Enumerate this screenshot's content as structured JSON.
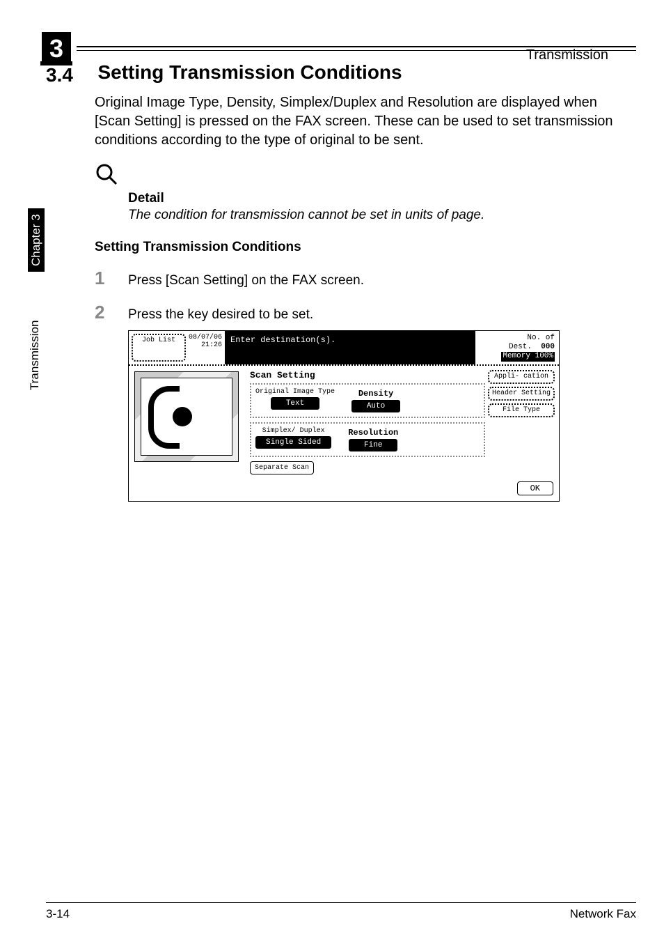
{
  "header": {
    "chapter_num": "3",
    "title": "Transmission"
  },
  "sidebar": {
    "chapter_label": "Chapter 3",
    "section_label": "Transmission"
  },
  "section": {
    "number": "3.4",
    "title": "Setting Transmission Conditions",
    "intro": "Original Image Type, Density, Simplex/Duplex and Resolution are displayed when [Scan Setting] is pressed on the FAX screen. These can be used to set transmission conditions according to the type of original to be sent."
  },
  "detail": {
    "label": "Detail",
    "text": "The condition for transmission cannot be set in units of page."
  },
  "subheading": "Setting Transmission Conditions",
  "steps": [
    {
      "num": "1",
      "text": "Press [Scan Setting] on the FAX screen."
    },
    {
      "num": "2",
      "text": "Press the key desired to be set."
    }
  ],
  "shot": {
    "job_list": "Job List",
    "date": "08/07/06",
    "time": "21:26",
    "prompt": "Enter destination(s).",
    "no_of_dest_label": "No. of Dest.",
    "no_of_dest_val": "000",
    "memory_label": "Memory",
    "memory_val": "100%",
    "panel_title": "Scan Setting",
    "orig_label": "Original Image Type",
    "orig_val": "Text",
    "density_label": "Density",
    "density_val": "Auto",
    "duplex_label": "Simplex/ Duplex",
    "duplex_val": "Single Sided",
    "res_label": "Resolution",
    "res_val": "Fine",
    "sep_scan": "Separate Scan",
    "tab_app": "Appli- cation",
    "tab_header": "Header Setting",
    "tab_file": "File Type",
    "ok": "OK"
  },
  "footer": {
    "page": "3-14",
    "doc": "Network Fax"
  }
}
